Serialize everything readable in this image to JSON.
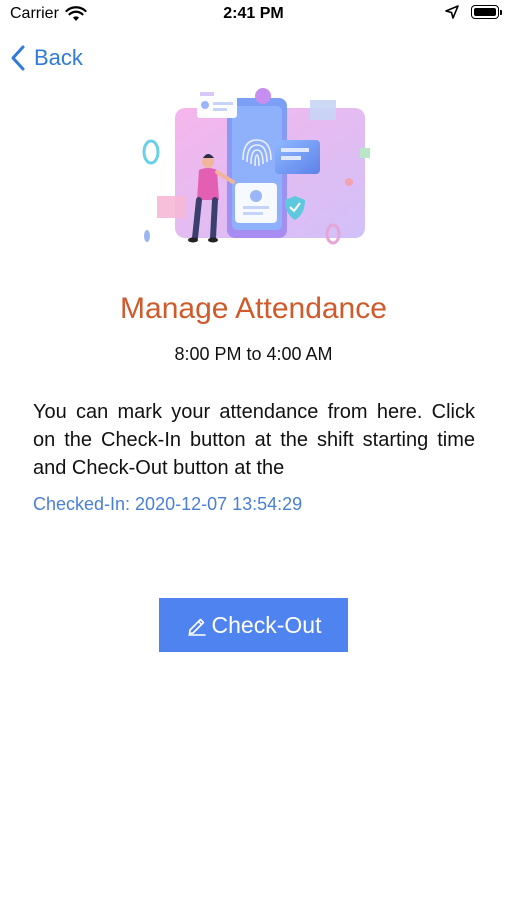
{
  "status_bar": {
    "carrier": "Carrier",
    "time": "2:41 PM",
    "icons": [
      "wifi-icon",
      "location-icon",
      "battery-icon"
    ]
  },
  "nav": {
    "back_label": "Back"
  },
  "main": {
    "title": "Manage Attendance",
    "shift_time": "8:00 PM to 4:00 AM",
    "description": "You can mark your attendance from here. Click on the Check-In button at the shift starting time and Check-Out button at the",
    "checked_in": "Checked-In: 2020-12-07 13:54:29",
    "checkout_label": "Check-Out"
  },
  "colors": {
    "accent_blue": "#2f7bd6",
    "title_orange": "#cf5a2b",
    "button_blue": "#4f83f0",
    "checked_in_blue": "#4a7fd6"
  }
}
